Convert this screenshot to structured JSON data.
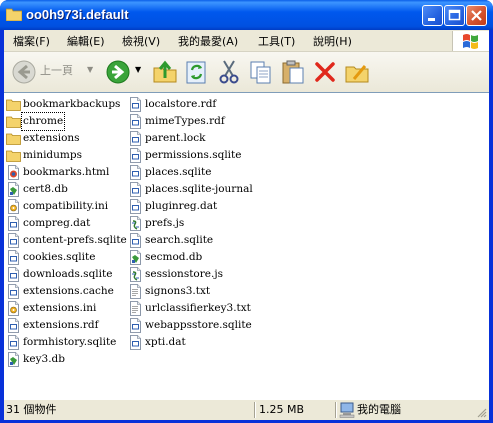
{
  "window": {
    "title": "oo0h973i.default"
  },
  "menu": [
    {
      "label": "檔案(F)"
    },
    {
      "label": "編輯(E)"
    },
    {
      "label": "檢視(V)"
    },
    {
      "label": "我的最愛(A)"
    },
    {
      "label": "工具(T)"
    },
    {
      "label": "說明(H)"
    }
  ],
  "toolbar": {
    "back_label": "上一頁",
    "icons": [
      "back-icon",
      "forward-icon",
      "up-folder-icon",
      "sync-icon",
      "cut-icon",
      "copy-icon",
      "paste-icon",
      "delete-icon",
      "folders-icon"
    ]
  },
  "files_col1": [
    {
      "name": "bookmarkbackups",
      "icon": "folder"
    },
    {
      "name": "chrome",
      "icon": "folder",
      "selected": true
    },
    {
      "name": "extensions",
      "icon": "folder"
    },
    {
      "name": "minidumps",
      "icon": "folder"
    },
    {
      "name": "bookmarks.html",
      "icon": "html"
    },
    {
      "name": "cert8.db",
      "icon": "db"
    },
    {
      "name": "compatibility.ini",
      "icon": "ini"
    },
    {
      "name": "compreg.dat",
      "icon": "generic"
    },
    {
      "name": "content-prefs.sqlite",
      "icon": "generic"
    },
    {
      "name": "cookies.sqlite",
      "icon": "generic"
    },
    {
      "name": "downloads.sqlite",
      "icon": "generic"
    },
    {
      "name": "extensions.cache",
      "icon": "generic"
    },
    {
      "name": "extensions.ini",
      "icon": "ini"
    },
    {
      "name": "extensions.rdf",
      "icon": "generic"
    },
    {
      "name": "formhistory.sqlite",
      "icon": "generic"
    },
    {
      "name": "key3.db",
      "icon": "db"
    }
  ],
  "files_col2": [
    {
      "name": "localstore.rdf",
      "icon": "generic"
    },
    {
      "name": "mimeTypes.rdf",
      "icon": "generic"
    },
    {
      "name": "parent.lock",
      "icon": "generic"
    },
    {
      "name": "permissions.sqlite",
      "icon": "generic"
    },
    {
      "name": "places.sqlite",
      "icon": "generic"
    },
    {
      "name": "places.sqlite-journal",
      "icon": "generic"
    },
    {
      "name": "pluginreg.dat",
      "icon": "generic"
    },
    {
      "name": "prefs.js",
      "icon": "js"
    },
    {
      "name": "search.sqlite",
      "icon": "generic"
    },
    {
      "name": "secmod.db",
      "icon": "db"
    },
    {
      "name": "sessionstore.js",
      "icon": "js"
    },
    {
      "name": "signons3.txt",
      "icon": "txt"
    },
    {
      "name": "urlclassifierkey3.txt",
      "icon": "txt"
    },
    {
      "name": "webappsstore.sqlite",
      "icon": "generic"
    },
    {
      "name": "xpti.dat",
      "icon": "generic"
    }
  ],
  "status": {
    "count": "31 個物件",
    "size": "1.25 MB",
    "location": "我的電腦"
  },
  "colors": {
    "title_blue": "#0058ee",
    "frame_blue": "#0831d9",
    "chrome_beige": "#ece9d8",
    "close_red": "#d5532f"
  }
}
